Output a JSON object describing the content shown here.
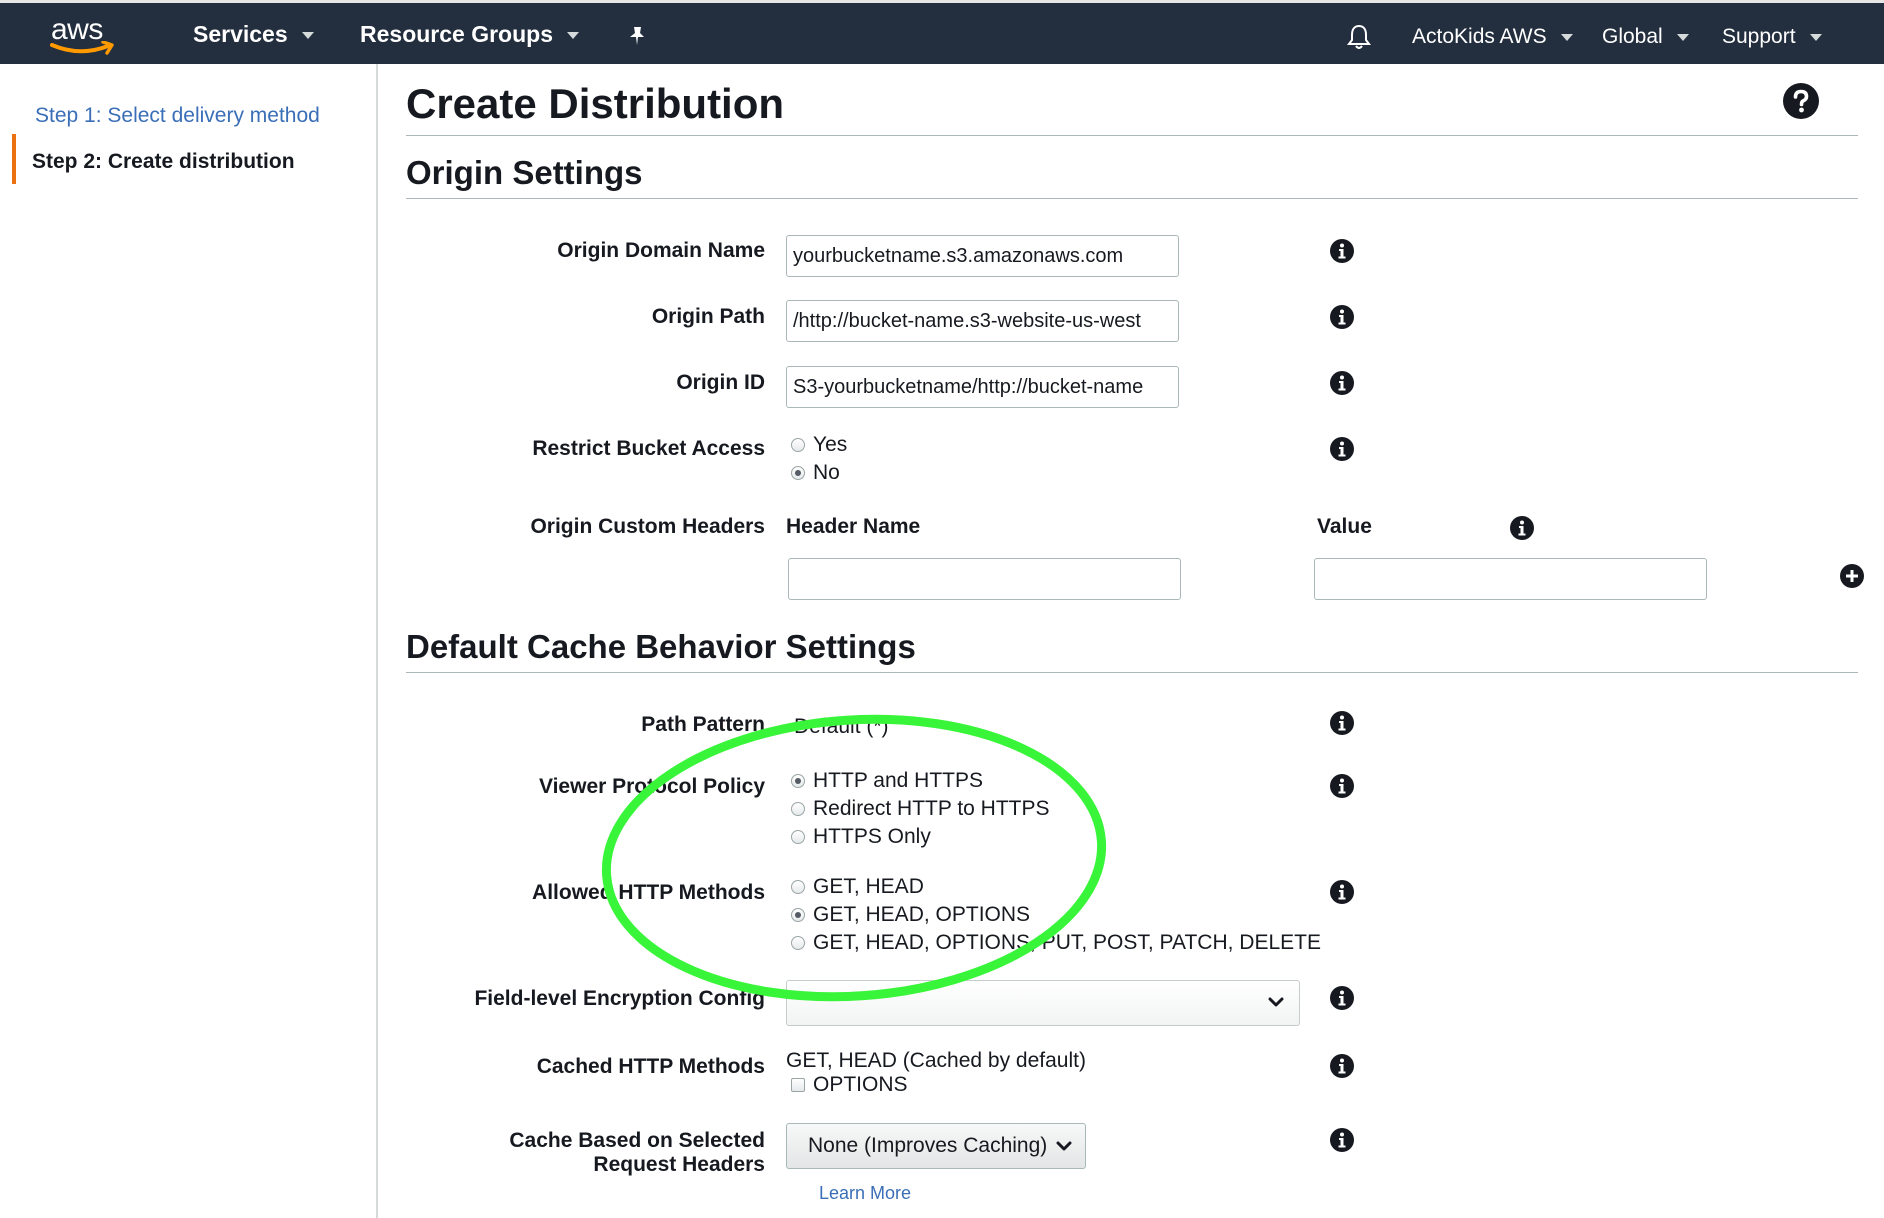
{
  "nav": {
    "logo_text": "aws",
    "services": "Services",
    "resource_groups": "Resource Groups",
    "account": "ActoKids AWS",
    "region": "Global",
    "support": "Support"
  },
  "sidebar": {
    "step1": "Step 1: Select delivery method",
    "step2": "Step 2: Create distribution"
  },
  "page": {
    "title": "Create Distribution"
  },
  "origin_settings": {
    "section_title": "Origin Settings",
    "origin_domain_name": {
      "label": "Origin Domain Name",
      "value": "yourbucketname.s3.amazonaws.com"
    },
    "origin_path": {
      "label": "Origin Path",
      "value": "/http://bucket-name.s3-website-us-west"
    },
    "origin_id": {
      "label": "Origin ID",
      "value": "S3-yourbucketname/http://bucket-name"
    },
    "restrict_bucket_access": {
      "label": "Restrict Bucket Access",
      "options": [
        "Yes",
        "No"
      ],
      "selected": "No"
    },
    "custom_headers": {
      "label": "Origin Custom Headers",
      "header_name_col": "Header Name",
      "value_col": "Value",
      "header_name_value": "",
      "value_value": ""
    }
  },
  "cache_behavior": {
    "section_title": "Default Cache Behavior Settings",
    "path_pattern": {
      "label": "Path Pattern",
      "value": "Default (*)"
    },
    "viewer_protocol_policy": {
      "label": "Viewer Protocol Policy",
      "options": [
        "HTTP and HTTPS",
        "Redirect HTTP to HTTPS",
        "HTTPS Only"
      ],
      "selected": "HTTP and HTTPS"
    },
    "allowed_http_methods": {
      "label": "Allowed HTTP Methods",
      "options": [
        "GET, HEAD",
        "GET, HEAD, OPTIONS",
        "GET, HEAD, OPTIONS, PUT, POST, PATCH, DELETE"
      ],
      "selected": "GET, HEAD, OPTIONS"
    },
    "field_level_encryption": {
      "label": "Field-level Encryption Config",
      "value": ""
    },
    "cached_http_methods": {
      "label": "Cached HTTP Methods",
      "text": "GET, HEAD (Cached by default)",
      "option": "OPTIONS",
      "checked": false
    },
    "cache_headers": {
      "label_line1": "Cache Based on Selected",
      "label_line2": "Request Headers",
      "value": "None (Improves Caching)",
      "learn_more": "Learn More"
    }
  },
  "colors": {
    "nav_bg": "#232f3e",
    "link": "#3a6fb7",
    "active_step_bar": "#ec7211",
    "annotation_ellipse": "#39f53a"
  }
}
